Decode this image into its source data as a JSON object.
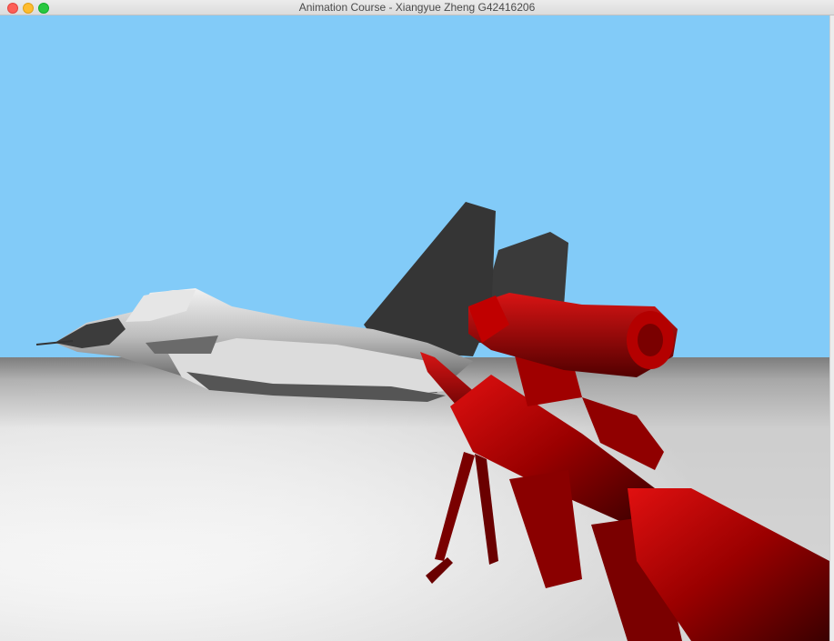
{
  "window": {
    "title": "Animation Course - Xiangyue Zheng G42416206"
  },
  "scene": {
    "sky_color": "#82cbf8",
    "ground_color": "#ffffff",
    "jet_color": "#3a3a3a",
    "rifle_color": "#b00000"
  }
}
